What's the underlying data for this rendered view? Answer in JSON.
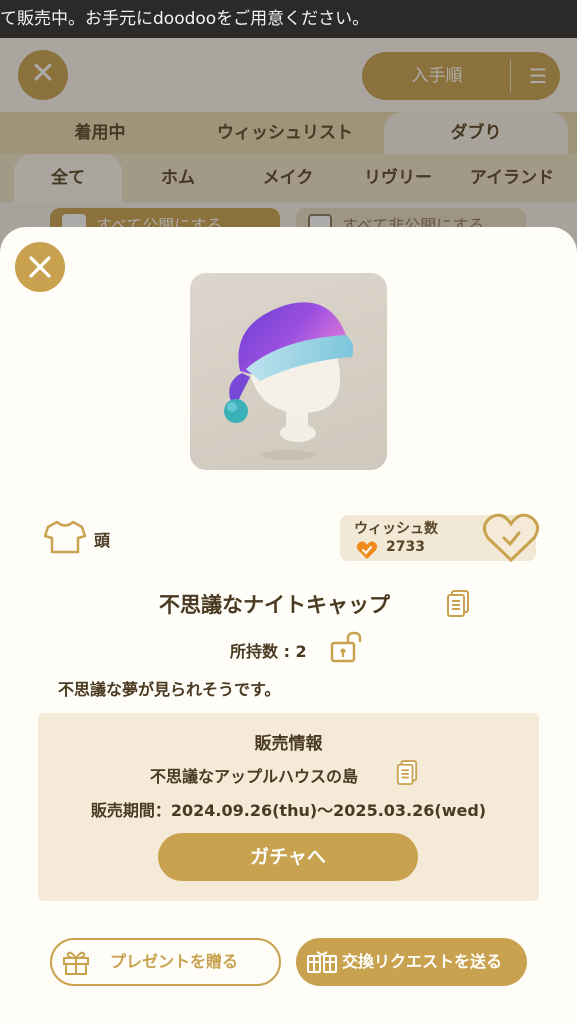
{
  "status_bar": {
    "marquee_text": "て販売中。お手元にdoodooをご用意ください。"
  },
  "background": {
    "sort_label": "入手順",
    "tabs": [
      "着用中",
      "ウィッシュリスト",
      "ダブり"
    ],
    "active_tab": "ダブり",
    "subtabs": [
      "全て",
      "ホム",
      "メイク",
      "リヴリー",
      "アイランド"
    ],
    "active_subtab": "全て",
    "publish_all_label": "すべて公開にする",
    "private_all_label": "すべて非公開にする"
  },
  "item": {
    "category": "頭",
    "wish_label": "ウィッシュ数",
    "wish_count": "2733",
    "name": "不思議なナイトキャップ",
    "owned_label": "所持数 : 2",
    "description": "不思議な夢が見られそうです。"
  },
  "sale": {
    "title": "販売情報",
    "shop": "不思議なアップルハウスの島",
    "period": "販売期間：2024.09.26(thu)〜2025.03.26(wed)",
    "gacha_button": "ガチャへ"
  },
  "actions": {
    "gift_button": "プレゼントを贈る",
    "trade_button": "交換リクエストを送る"
  },
  "colors": {
    "accent_gold": "#c9a24f",
    "panel_beige": "#f5ead8",
    "text_brown": "#4a3a22"
  }
}
